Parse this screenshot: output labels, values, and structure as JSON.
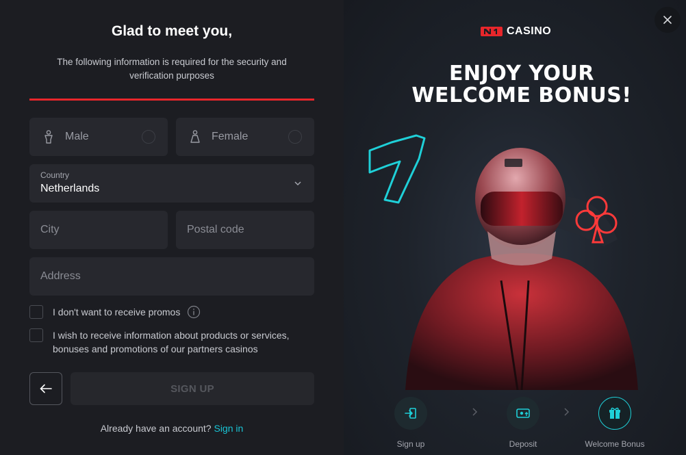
{
  "form": {
    "title": "Glad to meet you,",
    "subtitle": "The following information is required for the security and verification purposes",
    "gender": {
      "male": "Male",
      "female": "Female"
    },
    "country": {
      "label": "Country",
      "value": "Netherlands"
    },
    "city": {
      "placeholder": "City"
    },
    "postal": {
      "placeholder": "Postal code"
    },
    "address": {
      "placeholder": "Address"
    },
    "checkbox_promos": "I don't want to receive promos",
    "checkbox_partners": "I wish to receive information about products or services, bonuses and promotions of our partners casinos",
    "signup_label": "SIGN UP",
    "already_text": "Already have an account?",
    "signin_label": "Sign in"
  },
  "promo": {
    "logo_mark": "N1",
    "logo_text": "CASINO",
    "headline_line1": "ENJOY YOUR",
    "headline_line2": "WELCOME BONUS!",
    "steps": [
      {
        "label": "Sign up",
        "icon": "sign-in-icon"
      },
      {
        "label": "Deposit",
        "icon": "deposit-icon"
      },
      {
        "label": "Welcome Bonus",
        "icon": "gift-icon"
      }
    ]
  },
  "colors": {
    "accent_red": "#e8262b",
    "accent_cyan": "#19c5d6",
    "background": "#1c1d22",
    "field": "#27282e"
  }
}
